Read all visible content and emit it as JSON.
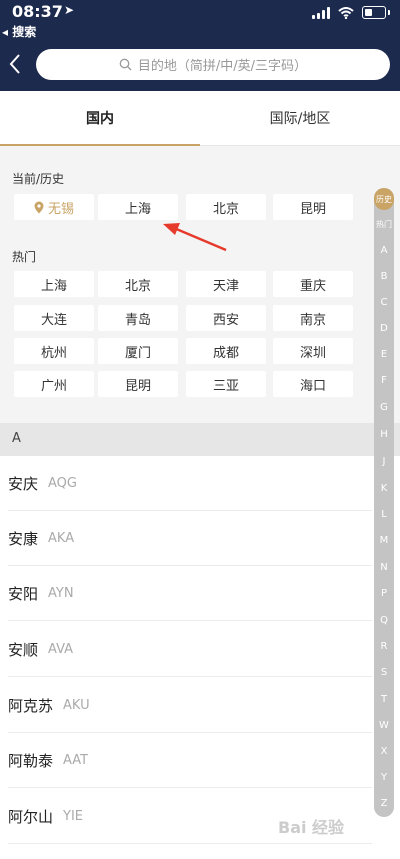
{
  "status": {
    "time": "08:37",
    "back_label": "◂ 搜索"
  },
  "search": {
    "placeholder": "目的地（简拼/中/英/三字码）"
  },
  "tabs": [
    {
      "label": "国内"
    },
    {
      "label": "国际/地区"
    }
  ],
  "history": {
    "title": "当前/历史",
    "items": [
      {
        "label": "无锡"
      },
      {
        "label": "上海"
      },
      {
        "label": "北京"
      },
      {
        "label": "昆明"
      }
    ]
  },
  "hot": {
    "title": "热门",
    "items": [
      {
        "label": "上海"
      },
      {
        "label": "北京"
      },
      {
        "label": "天津"
      },
      {
        "label": "重庆"
      },
      {
        "label": "大连"
      },
      {
        "label": "青岛"
      },
      {
        "label": "西安"
      },
      {
        "label": "南京"
      },
      {
        "label": "杭州"
      },
      {
        "label": "厦门"
      },
      {
        "label": "成都"
      },
      {
        "label": "深圳"
      },
      {
        "label": "广州"
      },
      {
        "label": "昆明"
      },
      {
        "label": "三亚"
      },
      {
        "label": "海口"
      }
    ]
  },
  "section_letter": "A",
  "cities": [
    {
      "name": "安庆",
      "code": "AQG"
    },
    {
      "name": "安康",
      "code": "AKA"
    },
    {
      "name": "安阳",
      "code": "AYN"
    },
    {
      "name": "安顺",
      "code": "AVA"
    },
    {
      "name": "阿克苏",
      "code": "AKU"
    },
    {
      "name": "阿勒泰",
      "code": "AAT"
    },
    {
      "name": "阿尔山",
      "code": "YIE"
    }
  ],
  "index": [
    "历史",
    "热门",
    "A",
    "B",
    "C",
    "D",
    "E",
    "F",
    "G",
    "H",
    "J",
    "K",
    "L",
    "M",
    "N",
    "P",
    "Q",
    "R",
    "S",
    "T",
    "W",
    "X",
    "Y",
    "Z"
  ],
  "colors": {
    "header": "#1c2a4e",
    "accent": "#c9a466",
    "annotation_arrow": "#e53a2c"
  },
  "watermark": "Bai 经验"
}
